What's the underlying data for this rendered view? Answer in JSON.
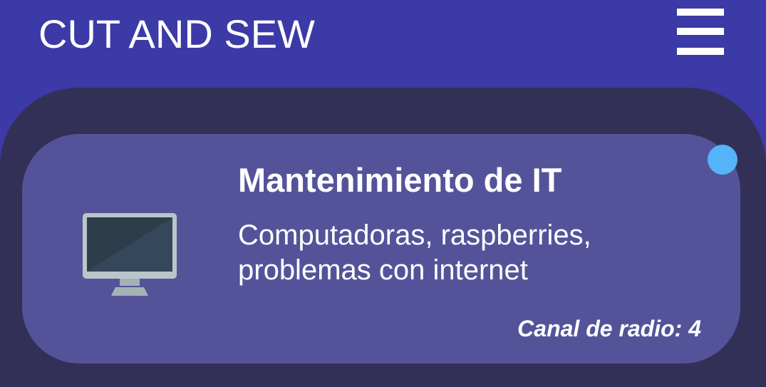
{
  "header": {
    "title": "CUT AND SEW",
    "menu_icon": "hamburger-menu-icon"
  },
  "card": {
    "icon": "desktop-monitor-icon",
    "title": "Mantenimiento de IT",
    "description": "Computadoras, raspberries, problemas con internet",
    "channel": "Canal de radio: 4",
    "status_color": "#53b4f8"
  },
  "colors": {
    "header_background": "#3c3aa6",
    "panel_background": "#333058",
    "card_background": "#54539a"
  }
}
